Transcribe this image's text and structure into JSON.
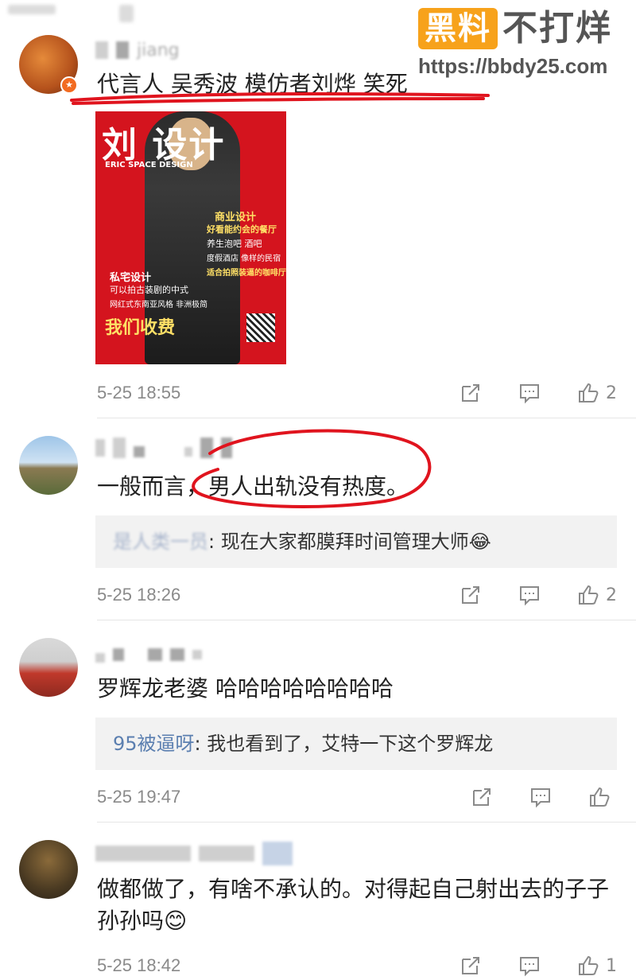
{
  "watermark": {
    "badge": "黑料",
    "text": "不打烊",
    "url": "https://bbdy25.com"
  },
  "colors": {
    "accent_orange": "#f7a21b",
    "link_blue": "#5b7fb0",
    "annotation_red": "#e0141e",
    "meta_gray": "#8a8a8a"
  },
  "comments": [
    {
      "username": "jiang",
      "text": "代言人 吴秀波 模仿者刘烨 笑死",
      "poster": {
        "title": "刘 设计",
        "subtitle": "ERIC SPACE DESIGN",
        "line1": "商业设计",
        "line2": "好看能约会的餐厅",
        "line3": "养生泡吧 酒吧",
        "line4": "度假酒店 像样的民宿",
        "line5": "适合拍照装逼的咖啡厅",
        "line6": "私宅设计",
        "line7": "可以拍古装剧的中式",
        "line8": "网红式东南亚风格 非洲极简",
        "slogan": "我们收费"
      },
      "time": "5-25 18:55",
      "likes": "2"
    },
    {
      "username": "",
      "text": "一般而言，男人出轨没有热度。",
      "reply_name": "是人类一员",
      "reply_text": ": 现在大家都膜拜时间管理大师😂",
      "time": "5-25 18:26",
      "likes": "2"
    },
    {
      "username": "",
      "text": "罗辉龙老婆 哈哈哈哈哈哈哈哈",
      "reply_name": "95被逼呀",
      "reply_text": ": 我也看到了，艾特一下这个罗辉龙",
      "time": "5-25 19:47",
      "likes": ""
    },
    {
      "username": "",
      "text": "做都做了，有啥不承认的。对得起自己射出去的子子孙孙吗😊",
      "time": "5-25 18:42",
      "likes": "1"
    }
  ]
}
